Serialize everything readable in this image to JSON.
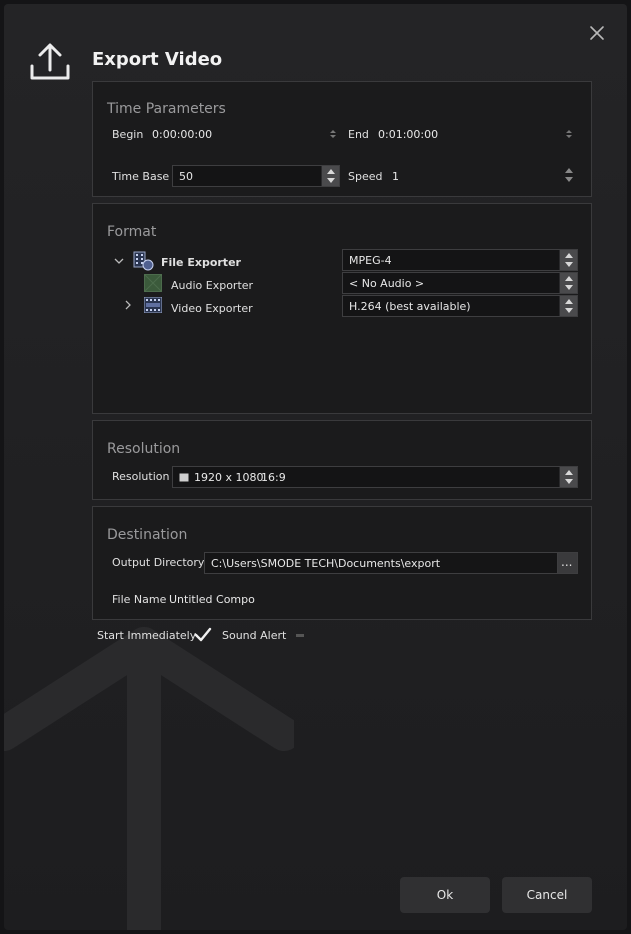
{
  "dialog": {
    "title": "Export Video",
    "icon": "upload-icon",
    "close_icon": "close-icon"
  },
  "time_parameters": {
    "title": "Time Parameters",
    "begin_label": "Begin",
    "begin_value": "0:00:00:00",
    "end_label": "End",
    "end_value": "0:01:00:00",
    "time_base_label": "Time Base",
    "time_base_value": "50",
    "speed_label": "Speed",
    "speed_value": "1"
  },
  "format": {
    "title": "Format",
    "file_exporter_label": "File Exporter",
    "file_exporter_value": "MPEG-4",
    "audio_exporter_label": "Audio Exporter",
    "audio_exporter_value": "< No Audio >",
    "video_exporter_label": "Video Exporter",
    "video_exporter_value": "H.264 (best available)"
  },
  "resolution": {
    "title": "Resolution",
    "label": "Resolution",
    "size": "1920 x 1080",
    "ratio": "16:9"
  },
  "destination": {
    "title": "Destination",
    "output_dir_label": "Output Directory",
    "output_dir_value": "C:\\Users\\SMODE TECH\\Documents\\export",
    "browse_label": "...",
    "file_name_label": "File Name",
    "file_name_value": "Untitled Compo"
  },
  "options": {
    "start_immediately_label": "Start Immediately",
    "sound_alert_label": "Sound Alert"
  },
  "buttons": {
    "ok": "Ok",
    "cancel": "Cancel"
  }
}
